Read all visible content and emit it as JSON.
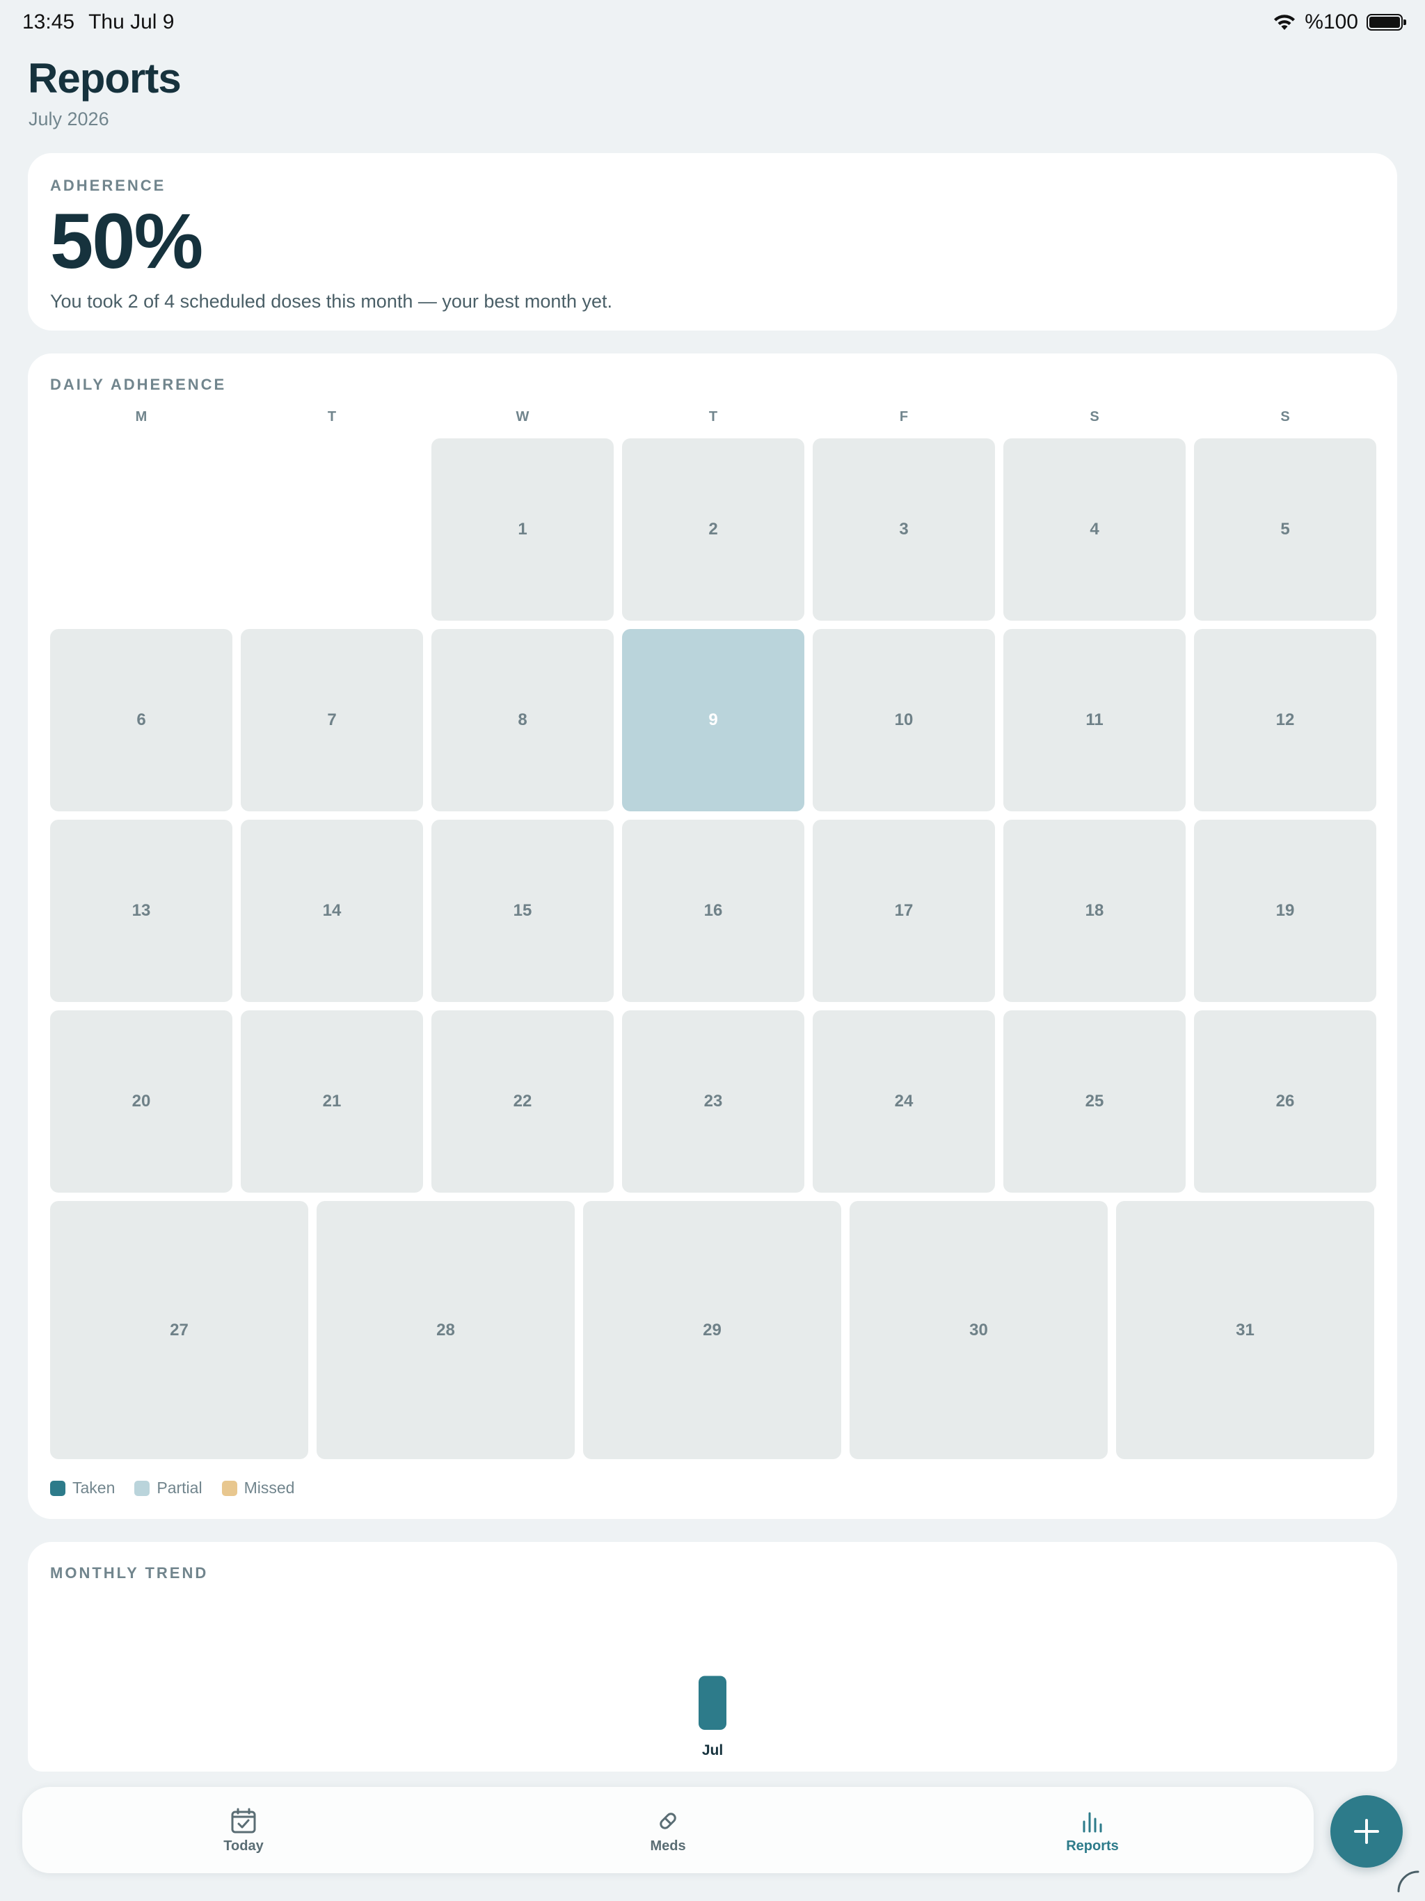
{
  "status_bar": {
    "time": "13:45",
    "date": "Thu Jul 9",
    "battery": "%100"
  },
  "header": {
    "title": "Reports",
    "subtitle": "July 2026"
  },
  "adherence": {
    "label": "ADHERENCE",
    "percent": "50%",
    "description": "You took 2 of 4 scheduled doses this month — your best month yet."
  },
  "calendar": {
    "label": "DAILY ADHERENCE",
    "weekdays": [
      "M",
      "T",
      "W",
      "T",
      "F",
      "S",
      "S"
    ],
    "weeks": [
      [
        "",
        "",
        "1",
        "2",
        "3",
        "4",
        "5"
      ],
      [
        "6",
        "7",
        "8",
        "9",
        "10",
        "11",
        "12"
      ],
      [
        "13",
        "14",
        "15",
        "16",
        "17",
        "18",
        "19"
      ],
      [
        "20",
        "21",
        "22",
        "23",
        "24",
        "25",
        "26"
      ]
    ],
    "last_week": [
      "27",
      "28",
      "29",
      "30",
      "31"
    ],
    "partial_days": [
      "9"
    ],
    "legend": [
      {
        "label": "Taken",
        "color": "#2d7b8a"
      },
      {
        "label": "Partial",
        "color": "#bad4db"
      },
      {
        "label": "Missed",
        "color": "#e8c78f"
      }
    ]
  },
  "trend": {
    "label": "MONTHLY TREND"
  },
  "chart_data": {
    "type": "bar",
    "categories": [
      "Jul"
    ],
    "values": [
      50
    ],
    "ylim": [
      0,
      100
    ],
    "color": "#2d7b8a"
  },
  "tabs": [
    {
      "label": "Today",
      "icon": "calendar-check-icon",
      "active": false
    },
    {
      "label": "Meds",
      "icon": "pill-icon",
      "active": false
    },
    {
      "label": "Reports",
      "icon": "bar-chart-icon",
      "active": true
    }
  ],
  "fab": {
    "icon": "plus-icon"
  },
  "colors": {
    "accent": "#2d7b8a",
    "partial": "#bad4db",
    "missed": "#e8c78f",
    "cell": "#e7ebeb"
  }
}
